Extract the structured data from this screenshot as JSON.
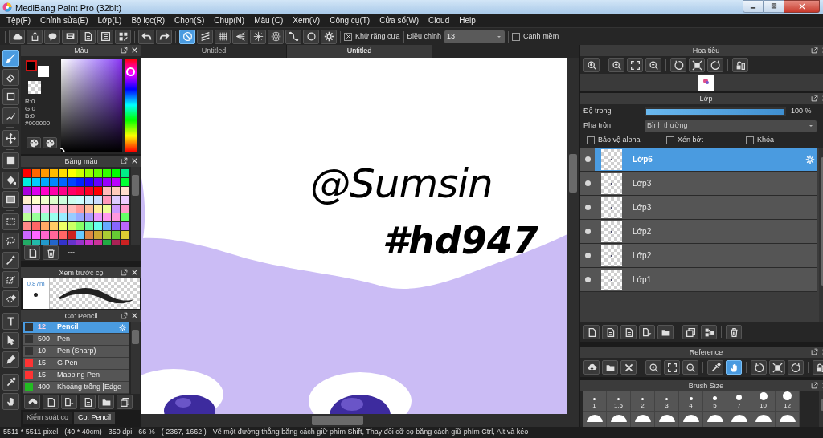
{
  "window": {
    "title": "MediBang Paint Pro (32bit)"
  },
  "menu": [
    "Tệp(F)",
    "Chỉnh sửa(E)",
    "Lớp(L)",
    "Bộ lọc(R)",
    "Chọn(S)",
    "Chụp(N)",
    "Màu (C)",
    "Xem(V)",
    "Công cụ(T)",
    "Cửa sổ(W)",
    "Cloud",
    "Help"
  ],
  "toolbar": {
    "snap_buttons": [
      {
        "selected": true
      },
      {
        "selected": false
      },
      {
        "selected": false
      },
      {
        "selected": false
      },
      {
        "selected": false
      },
      {
        "selected": false
      },
      {
        "selected": false
      },
      {
        "selected": false
      }
    ],
    "antialias": {
      "label": "Khử răng cưa",
      "checked": true
    },
    "correction": {
      "label": "Điều chỉnh",
      "value": "13"
    },
    "soft_edge": {
      "label": "Cạnh mềm",
      "checked": false
    }
  },
  "tools": [
    {
      "selected": true
    },
    {
      "selected": false
    },
    {
      "selected": false
    },
    {
      "selected": false
    },
    {
      "selected": false
    },
    {
      "selected": false
    },
    {
      "selected": false
    },
    {
      "selected": false
    },
    {
      "selected": false
    },
    {
      "selected": false
    },
    {
      "selected": false
    },
    {
      "selected": false
    },
    {
      "selected": false
    },
    {
      "selected": false
    },
    {
      "selected": false
    },
    {
      "selected": false
    },
    {
      "selected": false
    },
    {
      "selected": false
    }
  ],
  "color_panel": {
    "title": "Màu",
    "readout": [
      "R:0",
      "G:0",
      "B:0",
      "#000000"
    ]
  },
  "palette": {
    "title": "Bảng màu",
    "footer": "---",
    "swatches": [
      {
        "color": "#ff0000"
      },
      {
        "color": "#ff6600"
      },
      {
        "color": "#ff9900"
      },
      {
        "color": "#ffbb00"
      },
      {
        "color": "#ffdd00"
      },
      {
        "color": "#ffff00"
      },
      {
        "color": "#ccff00"
      },
      {
        "color": "#99ff00"
      },
      {
        "color": "#66ff00"
      },
      {
        "color": "#33ff00"
      },
      {
        "color": "#00ff00"
      },
      {
        "color": "#00ee88"
      },
      {
        "color": "#00eedd"
      },
      {
        "color": "#00ccff"
      },
      {
        "color": "#00aaff"
      },
      {
        "color": "#0088ff"
      },
      {
        "color": "#0066ff"
      },
      {
        "color": "#0044ff"
      },
      {
        "color": "#0022ff"
      },
      {
        "color": "#2200ff"
      },
      {
        "color": "#6600ff"
      },
      {
        "color": "#9900ff"
      },
      {
        "color": "#bb00ff"
      },
      {
        "color": "#00ff33"
      },
      {
        "color": "#aa00dd"
      },
      {
        "color": "#dd00ee"
      },
      {
        "color": "#ff00cc"
      },
      {
        "color": "#ff00aa"
      },
      {
        "color": "#ff0088"
      },
      {
        "color": "#ff0066"
      },
      {
        "color": "#ff0044"
      },
      {
        "color": "#ff0022"
      },
      {
        "color": "#ff0000"
      },
      {
        "color": "#ffbbbb"
      },
      {
        "color": "#ffccbb"
      },
      {
        "color": "#ffddcc"
      },
      {
        "color": "#ffeecc"
      },
      {
        "color": "#ffffcc"
      },
      {
        "color": "#eeffcc"
      },
      {
        "color": "#ddffcc"
      },
      {
        "color": "#ccffdd"
      },
      {
        "color": "#ccffee"
      },
      {
        "color": "#ccffff"
      },
      {
        "color": "#cceeff"
      },
      {
        "color": "#ccddff"
      },
      {
        "color": "#ff99bb"
      },
      {
        "color": "#ddccff"
      },
      {
        "color": "#eeccff"
      },
      {
        "color": "#ddbbff"
      },
      {
        "color": "#ffccff"
      },
      {
        "color": "#ffbbee"
      },
      {
        "color": "#ffbbdd"
      },
      {
        "color": "#ffbbcc"
      },
      {
        "color": "#ffbbbb"
      },
      {
        "color": "#ff9999"
      },
      {
        "color": "#ffbb99"
      },
      {
        "color": "#ffee99"
      },
      {
        "color": "#eeff99"
      },
      {
        "color": "#cc99ff"
      },
      {
        "color": "#ff99cc"
      },
      {
        "color": "#bbff99"
      },
      {
        "color": "#99ff99"
      },
      {
        "color": "#99ffcc"
      },
      {
        "color": "#99ffee"
      },
      {
        "color": "#99eeff"
      },
      {
        "color": "#99ccff"
      },
      {
        "color": "#99aaff"
      },
      {
        "color": "#aa99ff"
      },
      {
        "color": "#ee99ff"
      },
      {
        "color": "#ff99ee"
      },
      {
        "color": "#ff99dd"
      },
      {
        "color": "#66ff66"
      },
      {
        "color": "#ff8888"
      },
      {
        "color": "#ff6666"
      },
      {
        "color": "#ffaa66"
      },
      {
        "color": "#ffcc66"
      },
      {
        "color": "#eeff66"
      },
      {
        "color": "#ccff66"
      },
      {
        "color": "#88ff66"
      },
      {
        "color": "#66ffaa"
      },
      {
        "color": "#66ffee"
      },
      {
        "color": "#66aaff"
      },
      {
        "color": "#8866ff"
      },
      {
        "color": "#bb66ff"
      },
      {
        "color": "#cc66ff"
      },
      {
        "color": "#ff66ff"
      },
      {
        "color": "#ff66cc"
      },
      {
        "color": "#ff6699"
      },
      {
        "color": "#ff6666"
      },
      {
        "color": "#cc2222"
      },
      {
        "color": "#66ccff"
      },
      {
        "color": "#dd8844"
      },
      {
        "color": "#ccaa33"
      },
      {
        "color": "#aacc33"
      },
      {
        "color": "#66cc33"
      },
      {
        "color": "#ddcc33"
      },
      {
        "color": "#22aa66"
      },
      {
        "color": "#22bbaa"
      },
      {
        "color": "#2299cc"
      },
      {
        "color": "#2266cc"
      },
      {
        "color": "#3333cc"
      },
      {
        "color": "#6633cc"
      },
      {
        "color": "#9933cc"
      },
      {
        "color": "#cc33cc"
      },
      {
        "color": "#cc3399"
      },
      {
        "color": "#22aa44"
      },
      {
        "color": "#aa2255"
      },
      {
        "color": "#cc2222"
      }
    ]
  },
  "brush_preview": {
    "title": "Xem trước cọ",
    "size": "0.87m"
  },
  "brush_panel": {
    "title": "Cọ: Pencil",
    "brushes": [
      {
        "color": "#333333",
        "size": "12",
        "name": "Pencil",
        "selected": true
      },
      {
        "color": "#333333",
        "size": "500",
        "name": "Pen",
        "selected": false
      },
      {
        "color": "#333333",
        "size": "10",
        "name": "Pen (Sharp)",
        "selected": false
      },
      {
        "color": "#ff3333",
        "size": "15",
        "name": "G Pen",
        "selected": false
      },
      {
        "color": "#ff3333",
        "size": "15",
        "name": "Mapping Pen",
        "selected": false
      },
      {
        "color": "#22bb22",
        "size": "400",
        "name": "Khoảng trống [Edge",
        "selected": false
      }
    ],
    "tabs": [
      {
        "label": "Kiểm soát cọ",
        "selected": false
      },
      {
        "label": "Cọ: Pencil",
        "selected": true
      }
    ]
  },
  "document_tabs": [
    {
      "label": "Untitled",
      "selected": false
    },
    {
      "label": "Untitled",
      "selected": true
    }
  ],
  "canvas": {
    "lettering": [
      "@Sumsin",
      "#hd947"
    ]
  },
  "navigator": {
    "title": "Hoa tiêu"
  },
  "layers": {
    "title": "Lớp",
    "opacity": {
      "label": "Độ trong",
      "level": 1,
      "reading": "100 %"
    },
    "blend": {
      "label": "Pha trộn",
      "value": "Bình thường"
    },
    "options": [
      {
        "label": "Bảo vệ alpha",
        "checked": false
      },
      {
        "label": "Xén bớt",
        "checked": false
      },
      {
        "label": "Khóa",
        "checked": false
      }
    ],
    "items": [
      {
        "name": "Lớp6",
        "selected": true
      },
      {
        "name": "Lớp3",
        "selected": false
      },
      {
        "name": "Lớp3",
        "selected": false
      },
      {
        "name": "Lớp2",
        "selected": false
      },
      {
        "name": "Lớp2",
        "selected": false
      },
      {
        "name": "Lớp1",
        "selected": false
      }
    ]
  },
  "reference": {
    "title": "Reference",
    "tools": [
      {
        "selected": false
      },
      {
        "selected": false
      },
      {
        "selected": false
      },
      {
        "selected": false
      },
      {
        "selected": false
      },
      {
        "selected": false
      },
      {
        "selected": false
      },
      {
        "selected": true
      },
      {
        "selected": false
      },
      {
        "selected": false
      },
      {
        "selected": false
      },
      {
        "selected": false
      }
    ]
  },
  "brush_size": {
    "title": "Brush Size",
    "sizes": [
      "1",
      "1.5",
      "2",
      "3",
      "4",
      "5",
      "7",
      "10",
      "12"
    ]
  },
  "status_bar": {
    "dimensions": "5511 * 5511 pixel",
    "physical": "(40 * 40cm)",
    "resolution": "350 dpi",
    "zoom": "66 %",
    "cursor": "( 2367, 1662 )",
    "hint": "Vẽ một đường thẳng bằng cách giữ phím Shift, Thay đổi cỡ cọ bằng cách giữ phím Ctrl, Alt và kéo"
  }
}
